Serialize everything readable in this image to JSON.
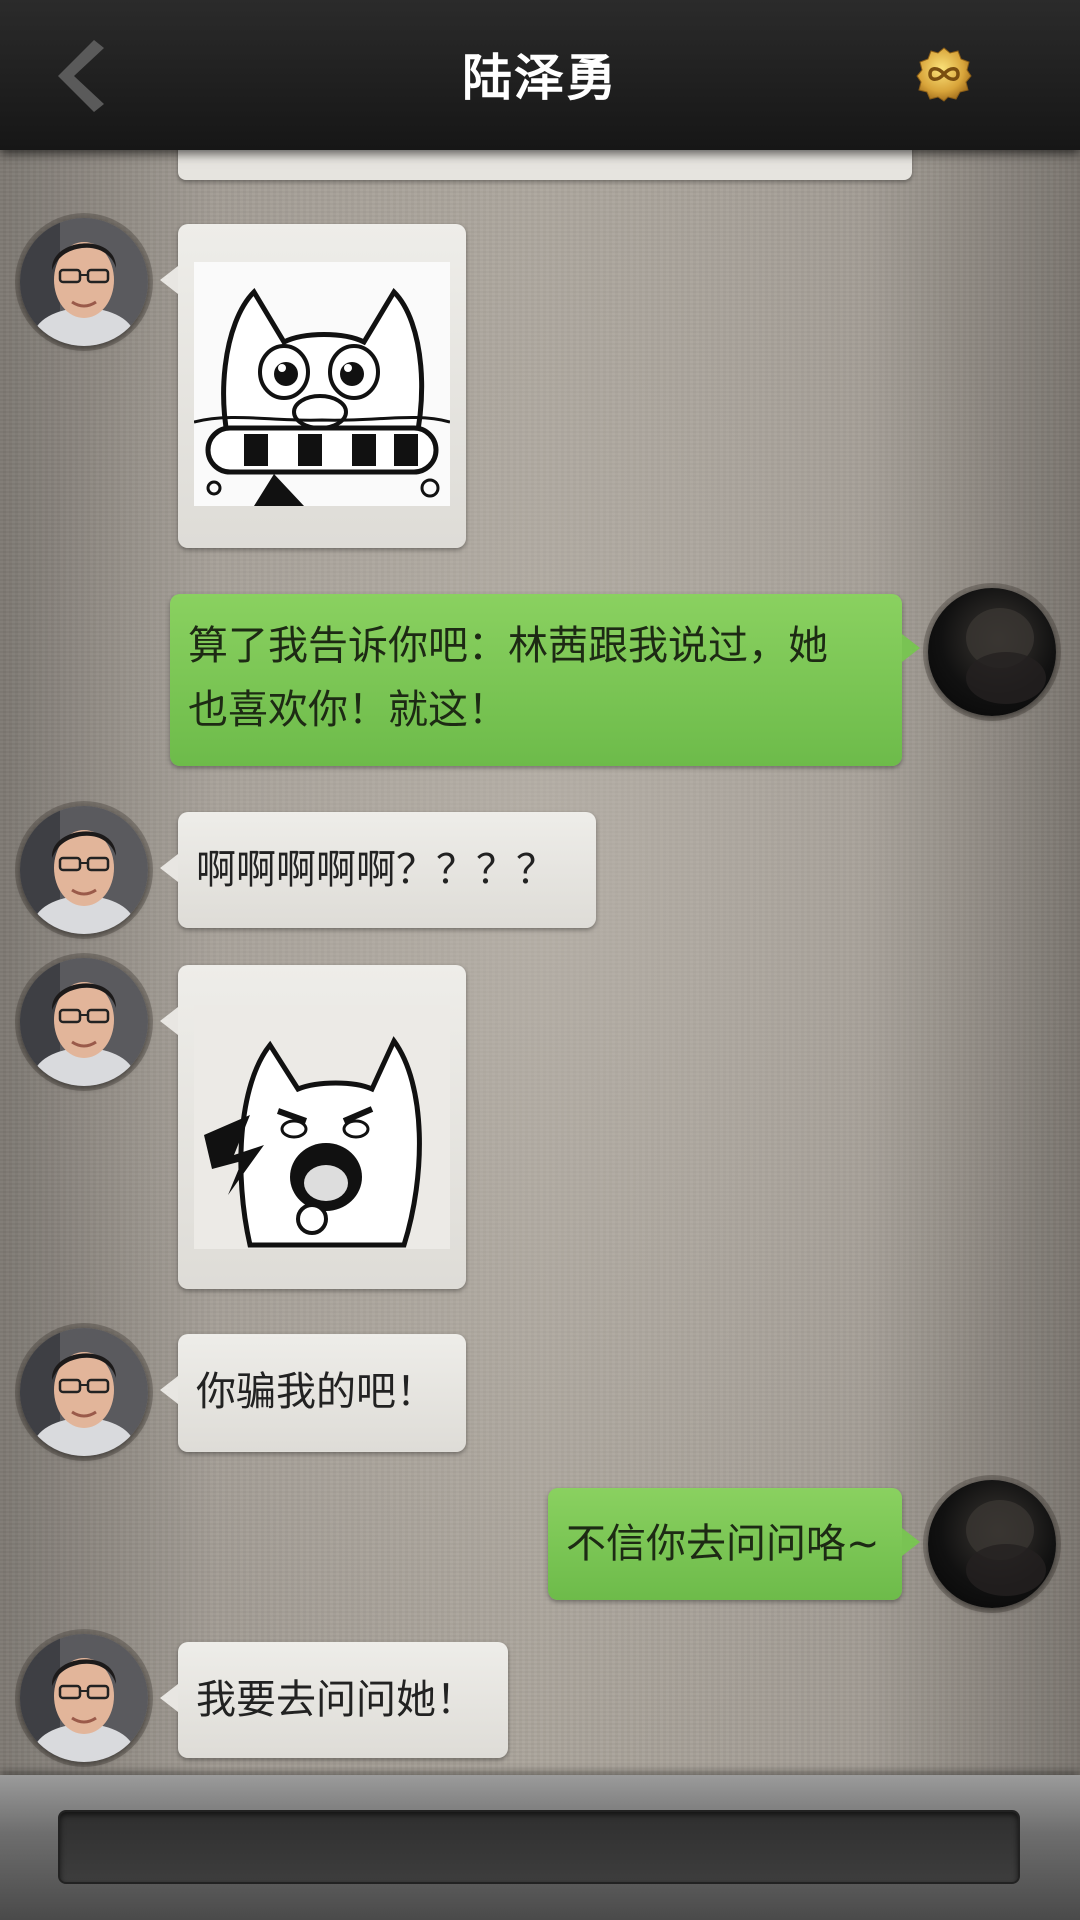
{
  "header": {
    "title": "陆泽勇",
    "back_icon": "chevron-left-icon",
    "coin_icon": "infinity-coin-icon"
  },
  "messages": [
    {
      "side": "left",
      "type": "sticker",
      "sticker": "cat-biting-phone-sticker"
    },
    {
      "side": "right",
      "type": "text",
      "text_line1": "算了我告诉你吧：林茜跟我说过，她",
      "text_line2": "也喜欢你！就这！"
    },
    {
      "side": "left",
      "type": "text",
      "text": "啊啊啊啊啊？？？？"
    },
    {
      "side": "left",
      "type": "sticker",
      "sticker": "cat-screaming-sticker"
    },
    {
      "side": "left",
      "type": "text",
      "text": "你骗我的吧！"
    },
    {
      "side": "right",
      "type": "text",
      "text": "不信你去问问咯~"
    },
    {
      "side": "left",
      "type": "text",
      "text": "我要去问问她！"
    }
  ],
  "input": {
    "value": "",
    "placeholder": ""
  },
  "colors": {
    "header_bg": "#1c1c1c",
    "incoming_bubble": "#e6e4df",
    "outgoing_bubble": "#7dc557",
    "chat_bg": "#a09a92"
  }
}
